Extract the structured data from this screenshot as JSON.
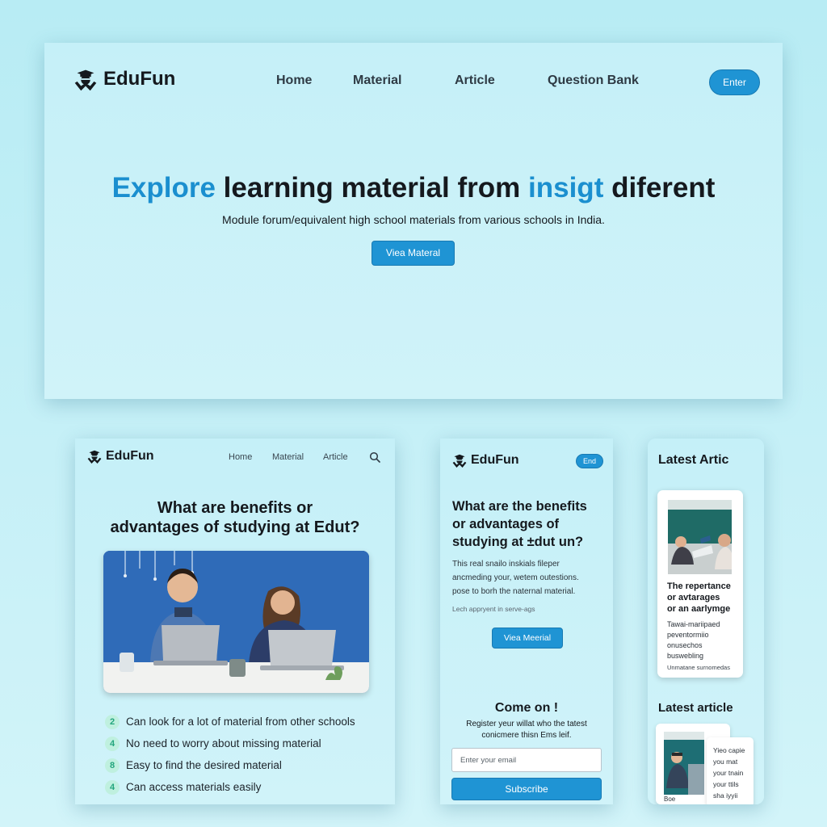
{
  "brand": {
    "name": "EduFun",
    "logo_icon": "graduate-icon",
    "accent_color": "#1f94d4",
    "highlight_color": "#1b8fcf",
    "check_color": "#23a57d"
  },
  "desktop": {
    "nav": [
      "Home",
      "Material",
      "Article",
      "Question Bank"
    ],
    "enter_label": "Enter",
    "hero": {
      "title_part1": "Explore",
      "title_part2": " learning material from ",
      "title_part3": "insigt",
      "title_part4": " diferent",
      "subtitle": "Module forum/equivalent high school materials from various schools in India.",
      "button_label": "Viea Materal"
    }
  },
  "tablet": {
    "nav": [
      "Home",
      "Material",
      "Article"
    ],
    "search_icon": "search-icon",
    "heading_line1": "What are benefits or",
    "heading_line2": "advantages of studying at Edut?",
    "benefits": [
      {
        "num": "2",
        "text": "Can look for a lot of material from other schools"
      },
      {
        "num": "4",
        "text": "No need to worry about missing material"
      },
      {
        "num": "8",
        "text": "Easy to find the desired material"
      },
      {
        "num": "4",
        "text": "Can access materials easily"
      }
    ]
  },
  "mobile": {
    "end_label": "End",
    "heading_line1": "What are the benefits",
    "heading_line2": "or advantages of",
    "heading_line3": "studying at ±dut un?",
    "body_line1": "This real snailo inskials fileper",
    "body_line2": "ancmeding your, wetem outestions.",
    "body_line3": "pose to borh the naternal material.",
    "note": "Lech appryent in serve-ags",
    "button_label": "Viea Meerial",
    "cta_title": "Come on !",
    "cta_line1": "Register yeur willat who the tatest",
    "cta_line2": "conicmere thisn Ems leif.",
    "email_placeholder": "Enter your email",
    "subscribe_label": "Subscribe"
  },
  "articles": {
    "title1": "Latest Artic",
    "card1": {
      "title_line1": "The repertance",
      "title_line2": "or avtarages",
      "title_line3": "or an aarlymge",
      "body_line1": "Tawai-mariipaed",
      "body_line2": "peventormiio",
      "body_line3": "onusechos",
      "body_line4": "buswebling",
      "footer": "Unmatane surnomedas"
    },
    "title2": "Latest article",
    "card2": {
      "footer": "Boe"
    },
    "card3": {
      "body_line1": "Yieo capie",
      "body_line2": "you mat",
      "body_line3": "your tnain",
      "body_line4": "your ttils",
      "body_line5": "sha iyyii"
    }
  }
}
